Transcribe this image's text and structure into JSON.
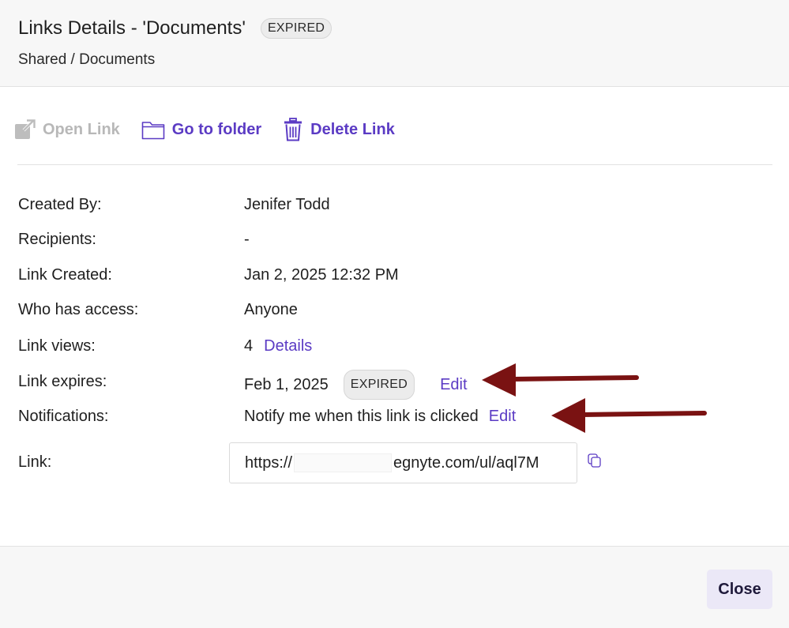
{
  "header": {
    "title": "Links Details - 'Documents'",
    "status_badge": "EXPIRED",
    "breadcrumb": "Shared / Documents"
  },
  "toolbar": {
    "open_link": "Open Link",
    "go_to_folder": "Go to folder",
    "delete_link": "Delete Link"
  },
  "details": {
    "created_by_label": "Created By:",
    "created_by": "Jenifer Todd",
    "recipients_label": "Recipients:",
    "recipients": "-",
    "link_created_label": "Link Created:",
    "link_created": "Jan 2, 2025 12:32 PM",
    "access_label": "Who has access:",
    "access": "Anyone",
    "views_label": "Link views:",
    "views": "4",
    "views_details": "Details",
    "expires_label": "Link expires:",
    "expires": "Feb 1, 2025",
    "expires_badge": "EXPIRED",
    "expires_edit": "Edit",
    "notifications_label": "Notifications:",
    "notifications": "Notify me when this link is clicked",
    "notifications_edit": "Edit",
    "link_label": "Link:",
    "link_prefix": "https://",
    "link_suffix": "egnyte.com/ul/aql7M"
  },
  "footer": {
    "close": "Close"
  },
  "colors": {
    "accent": "#5b3bc4",
    "annotation_arrow": "#7a1212",
    "disabled": "#b8b8b8"
  },
  "icons": {
    "open_link": "external-link-icon",
    "go_to_folder": "folder-icon",
    "delete_link": "trash-icon",
    "copy": "copy-icon"
  }
}
